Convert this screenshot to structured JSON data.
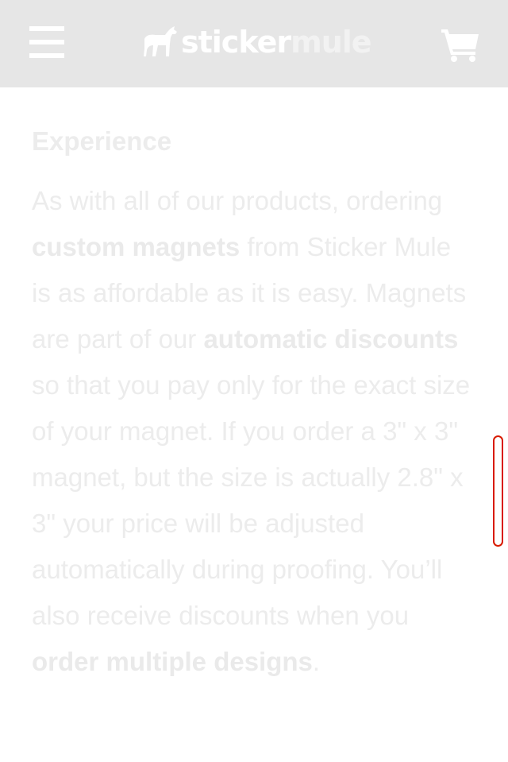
{
  "header": {
    "menu_icon": "hamburger-menu-icon",
    "logo_icon": "mule-logo-icon",
    "logo_word1": "sticker",
    "logo_word2": "mule",
    "cart_icon": "shopping-cart-icon"
  },
  "article": {
    "title": "Experience",
    "p1_a": "As with all of our products, ordering ",
    "p1_link1": "custom magnets",
    "p1_b": " from Sticker Mule is as affordable as it is easy. Magnets are part of our ",
    "p1_link2": "automatic discounts",
    "p1_c": " so that you pay only for the exact size of your magnet. If you order a 3\" x 3\" magnet, but the size is actually 2.8\" x 3\" your price will be adjusted automatically during proofing. You’ll also receive discounts when you ",
    "p1_link3": "order multiple designs",
    "p1_d": "."
  },
  "colors": {
    "header_bg": "#e6e6e6",
    "scroll_accent": "#d81a00"
  }
}
